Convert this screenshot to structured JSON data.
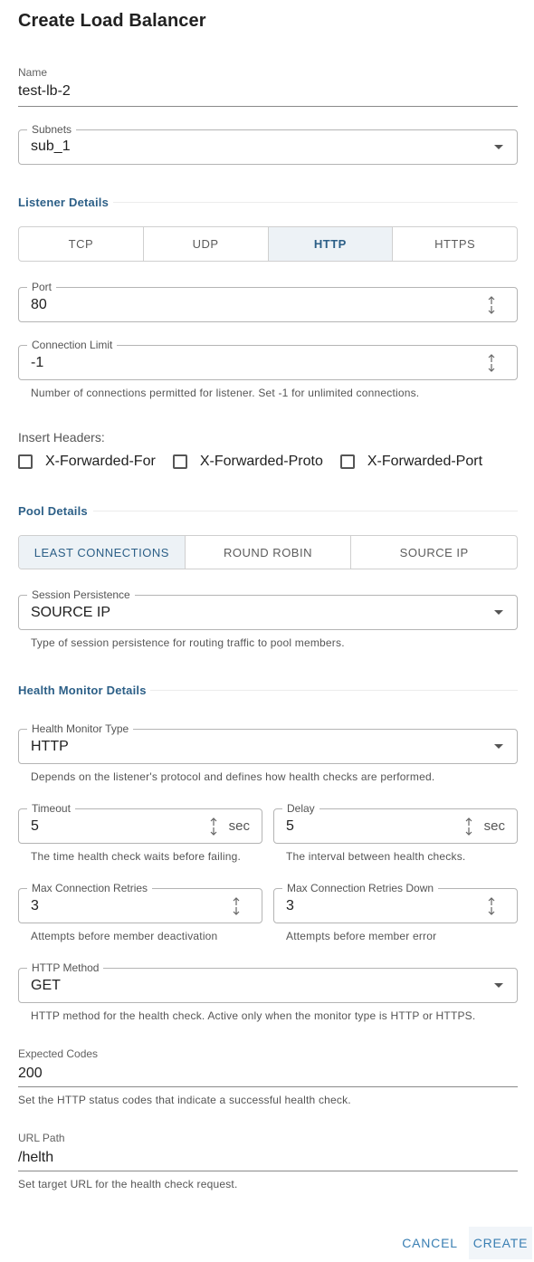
{
  "dialog": {
    "title": "Create Load Balancer"
  },
  "name": {
    "label": "Name",
    "value": "test-lb-2"
  },
  "subnets": {
    "label": "Subnets",
    "value": "sub_1"
  },
  "listener": {
    "section_title": "Listener Details",
    "protocols": [
      "TCP",
      "UDP",
      "HTTP",
      "HTTPS"
    ],
    "selected_protocol": "HTTP",
    "port": {
      "label": "Port",
      "value": "80"
    },
    "connection_limit": {
      "label": "Connection Limit",
      "value": "-1",
      "helper": "Number of connections permitted for listener. Set -1 for unlimited connections."
    },
    "insert_headers": {
      "label": "Insert Headers:",
      "options": [
        {
          "label": "X-Forwarded-For",
          "checked": false
        },
        {
          "label": "X-Forwarded-Proto",
          "checked": false
        },
        {
          "label": "X-Forwarded-Port",
          "checked": false
        }
      ]
    }
  },
  "pool": {
    "section_title": "Pool Details",
    "algorithms": [
      "LEAST CONNECTIONS",
      "ROUND ROBIN",
      "SOURCE IP"
    ],
    "selected_algorithm": "LEAST CONNECTIONS",
    "session_persistence": {
      "label": "Session Persistence",
      "value": "SOURCE IP",
      "helper": "Type of session persistence for routing traffic to pool members."
    }
  },
  "health": {
    "section_title": "Health Monitor Details",
    "monitor_type": {
      "label": "Health Monitor Type",
      "value": "HTTP",
      "helper": "Depends on the listener's protocol and defines how health checks are performed."
    },
    "timeout": {
      "label": "Timeout",
      "value": "5",
      "unit": "sec",
      "helper": "The time health check waits before failing."
    },
    "delay": {
      "label": "Delay",
      "value": "5",
      "unit": "sec",
      "helper": "The interval between health checks."
    },
    "max_retries": {
      "label": "Max Connection Retries",
      "value": "3",
      "helper": "Attempts before member deactivation"
    },
    "max_retries_down": {
      "label": "Max Connection Retries Down",
      "value": "3",
      "helper": "Attempts before member error"
    },
    "http_method": {
      "label": "HTTP Method",
      "value": "GET",
      "helper": "HTTP method for the health check. Active only when the monitor type is HTTP or HTTPS."
    },
    "expected_codes": {
      "label": "Expected Codes",
      "value": "200",
      "helper": "Set the HTTP status codes that indicate a successful health check."
    },
    "url_path": {
      "label": "URL Path",
      "value": "/helth",
      "helper": "Set target URL for the health check request."
    }
  },
  "actions": {
    "cancel": "CANCEL",
    "create": "CREATE"
  },
  "colors": {
    "accent": "#2c5f87",
    "button_text": "#3a7fb3",
    "active_segment_bg": "#edf2f6"
  },
  "icons": {
    "dropdown": "chevron-down-icon",
    "stepper": "stepper-arrows-icon",
    "checkbox": "checkbox-unchecked-icon"
  }
}
